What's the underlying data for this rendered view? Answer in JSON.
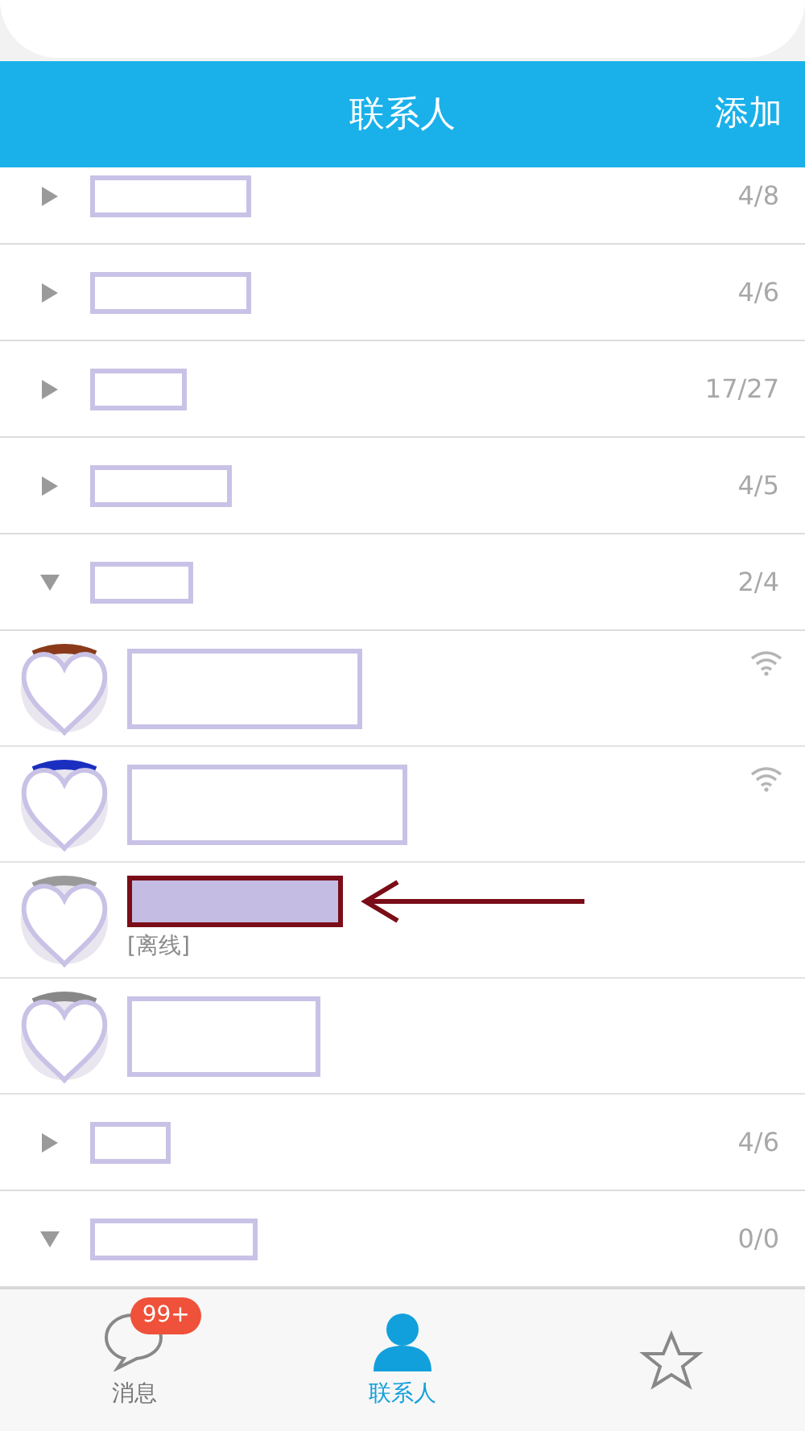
{
  "header": {
    "title": "联系人",
    "action": "添加"
  },
  "groups": [
    {
      "count": "4/8",
      "expanded": false
    },
    {
      "count": "4/6",
      "expanded": false
    },
    {
      "count": "17/27",
      "expanded": false
    },
    {
      "count": "4/5",
      "expanded": false
    },
    {
      "count": "2/4",
      "expanded": true,
      "contacts": [
        {
          "online": true,
          "highlighted": false
        },
        {
          "online": true,
          "highlighted": false
        },
        {
          "online": false,
          "status": "[离线]",
          "highlighted": true
        },
        {
          "online": false,
          "highlighted": false
        }
      ]
    },
    {
      "count": "4/6",
      "expanded": false
    },
    {
      "count": "0/0",
      "expanded": true
    }
  ],
  "tabs": [
    {
      "label": "消息",
      "badge": "99+",
      "selected": false
    },
    {
      "label": "联系人",
      "selected": true
    },
    {
      "selected": false
    }
  ]
}
